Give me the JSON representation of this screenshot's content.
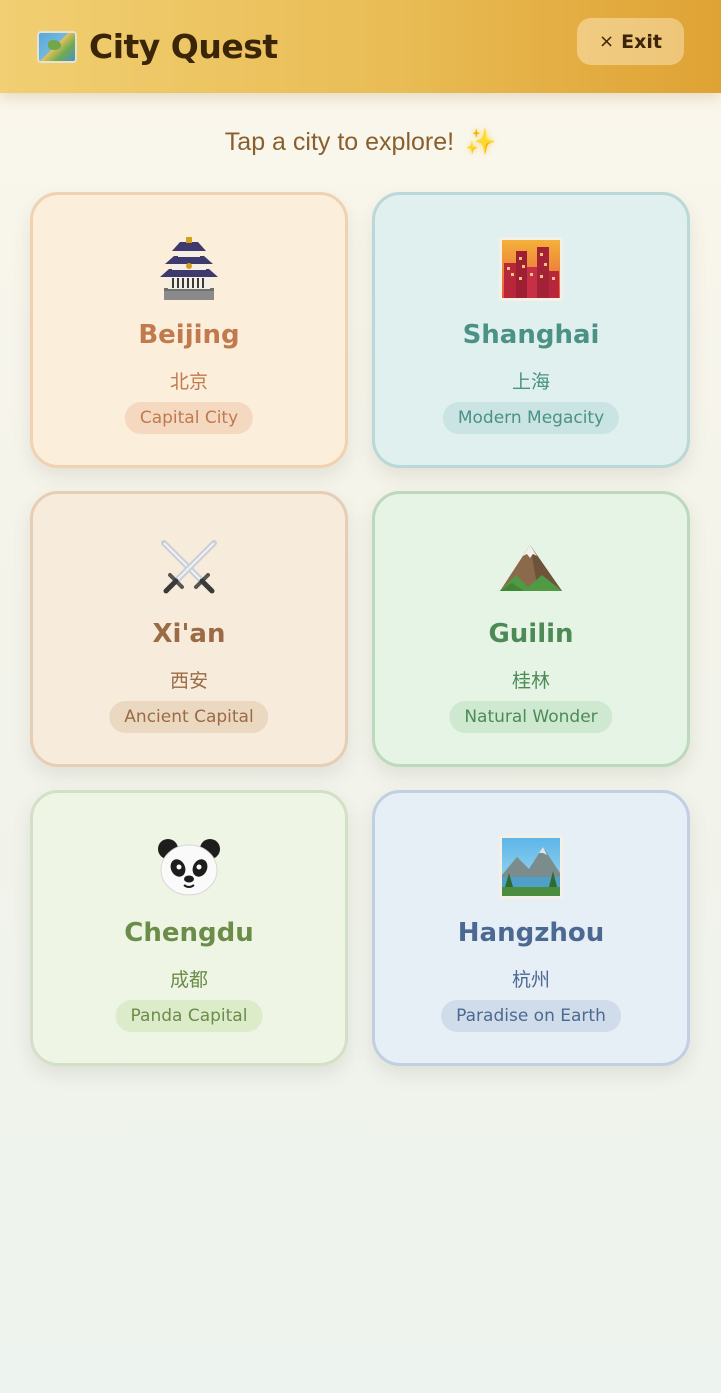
{
  "header": {
    "app_title": "City Quest",
    "exit_icon": "×",
    "exit_label": "Exit"
  },
  "prompt": {
    "text": "Tap a city to explore!",
    "star_icon": "✨"
  },
  "cities": [
    {
      "name": "Beijing",
      "chinese": "北京",
      "tag": "Capital City",
      "icon": "pagoda-icon"
    },
    {
      "name": "Shanghai",
      "chinese": "上海",
      "tag": "Modern Megacity",
      "icon": "city-skyline-icon"
    },
    {
      "name": "Xi'an",
      "chinese": "西安",
      "tag": "Ancient Capital",
      "icon": "crossed-swords-icon"
    },
    {
      "name": "Guilin",
      "chinese": "桂林",
      "tag": "Natural Wonder",
      "icon": "mountain-icon"
    },
    {
      "name": "Chengdu",
      "chinese": "成都",
      "tag": "Panda Capital",
      "icon": "panda-icon"
    },
    {
      "name": "Hangzhou",
      "chinese": "杭州",
      "tag": "Paradise on Earth",
      "icon": "landscape-icon"
    }
  ],
  "colors": {
    "header_gradient_start": "#f1cf72",
    "header_gradient_end": "#dfa234",
    "title_text": "#3b2508",
    "beijing_accent": "#c07a4e",
    "shanghai_accent": "#4b9185",
    "xian_accent": "#9a6b45",
    "guilin_accent": "#4d8a56",
    "chengdu_accent": "#6b8d49",
    "hangzhou_accent": "#4c6a91"
  }
}
